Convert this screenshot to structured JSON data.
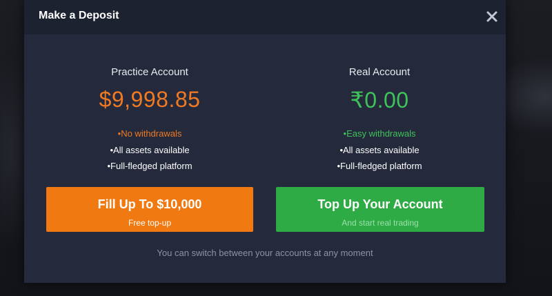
{
  "modal": {
    "title": "Make a Deposit",
    "close_icon": "close-icon"
  },
  "practice": {
    "name": "Practice Account",
    "balance": "$9,998.85",
    "accent_color": "#f07a23",
    "features": [
      "No withdrawals",
      "All assets available",
      "Full-fledged platform"
    ],
    "button_title": "Fill Up To $10,000",
    "button_subtitle": "Free top-up",
    "button_color": "#f07a11"
  },
  "real": {
    "name": "Real Account",
    "balance": "₹0.00",
    "accent_color": "#3fc25a",
    "features": [
      "Easy withdrawals",
      "All assets available",
      "Full-fledged platform"
    ],
    "button_title": "Top Up Your Account",
    "button_subtitle": "And start real trading",
    "button_color": "#2eab45"
  },
  "footer_note": "You can switch between your accounts at any moment"
}
